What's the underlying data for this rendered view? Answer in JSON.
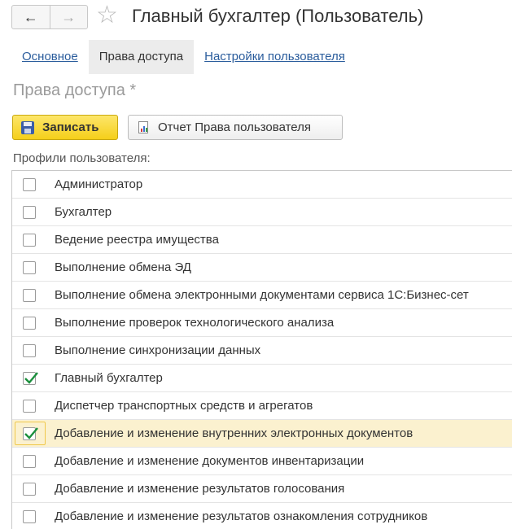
{
  "window": {
    "title": "Главный бухгалтер (Пользователь)",
    "nav_back_icon": "arrow-left-icon",
    "nav_forward_icon": "arrow-right-icon",
    "favorite_icon": "star-icon"
  },
  "tabs": [
    {
      "label": "Основное",
      "active": false
    },
    {
      "label": "Права доступа",
      "active": true
    },
    {
      "label": "Настройки пользователя",
      "active": false
    }
  ],
  "section_heading": "Права доступа *",
  "toolbar": {
    "save_label": "Записать",
    "report_label": "Отчет Права пользователя"
  },
  "profiles_label": "Профили пользователя:",
  "profiles": [
    {
      "label": "Администратор",
      "checked": false
    },
    {
      "label": "Бухгалтер",
      "checked": false
    },
    {
      "label": "Ведение реестра имущества",
      "checked": false
    },
    {
      "label": "Выполнение обмена ЭД",
      "checked": false
    },
    {
      "label": "Выполнение обмена электронными документами сервиса 1С:Бизнес-сет",
      "checked": false
    },
    {
      "label": "Выполнение проверок технологического анализа",
      "checked": false
    },
    {
      "label": "Выполнение синхронизации данных",
      "checked": false
    },
    {
      "label": "Главный бухгалтер",
      "checked": true
    },
    {
      "label": "Диспетчер транспортных средств и агрегатов",
      "checked": false
    },
    {
      "label": "Добавление и изменение внутренних электронных документов",
      "checked": true,
      "selected": true
    },
    {
      "label": "Добавление и изменение документов инвентаризации",
      "checked": false
    },
    {
      "label": "Добавление и изменение результатов голосования",
      "checked": false
    },
    {
      "label": "Добавление и изменение результатов ознакомления сотрудников",
      "checked": false
    }
  ],
  "colors": {
    "accent_link": "#2a5c9c",
    "save_button": "#f5cf1a",
    "check": "#1a8f3c",
    "selection": "#fbf1cf"
  }
}
